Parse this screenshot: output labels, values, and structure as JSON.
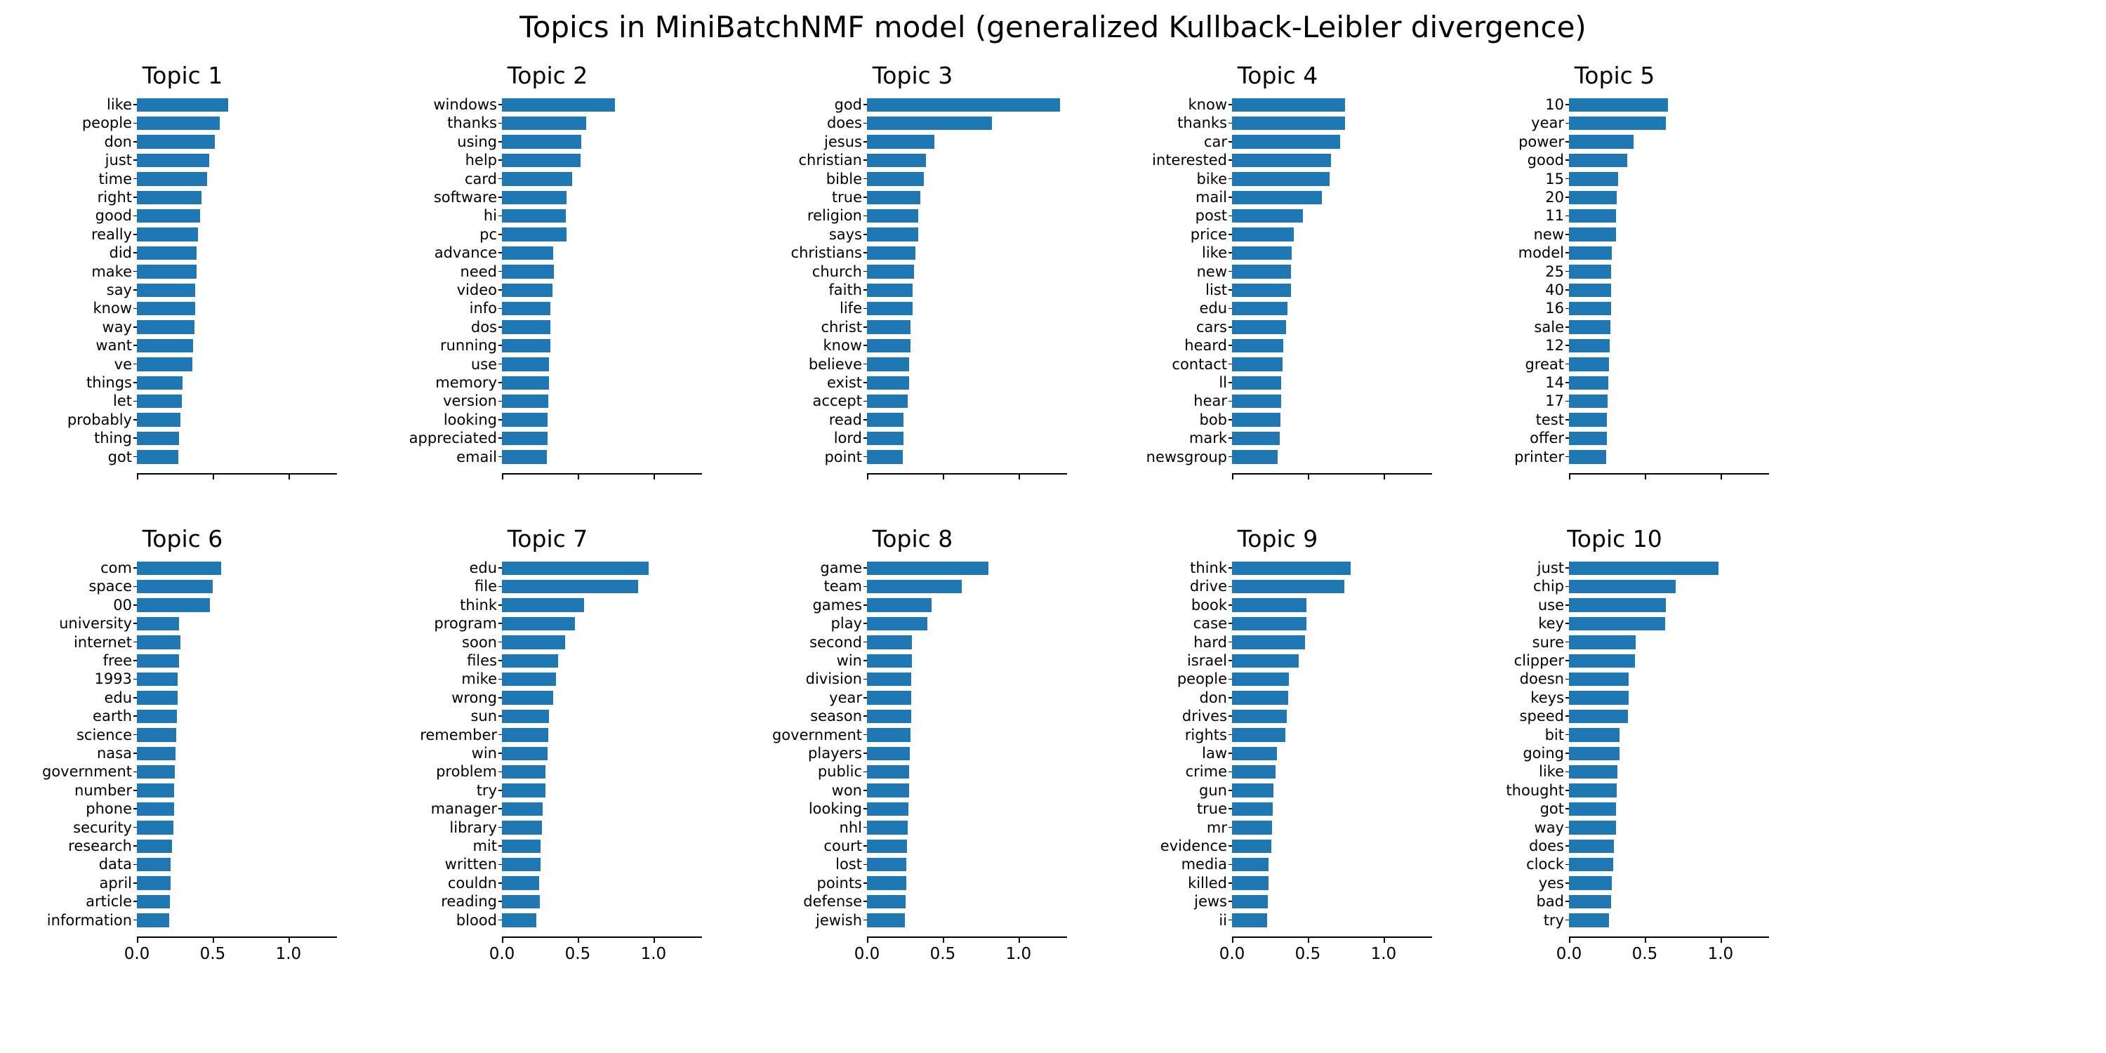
{
  "figure": {
    "title": "Topics in MiniBatchNMF model (generalized Kullback-Leibler divergence)",
    "bar_color": "#1f77b4",
    "background": "#ffffff",
    "rows": 2,
    "cols": 5
  },
  "axis": {
    "xticks": [
      0.0,
      0.5,
      1.0
    ],
    "xtick_labels": [
      "0.0",
      "0.5",
      "1.0"
    ],
    "xmin": 0.0,
    "xmax": 1.32,
    "xtick_labels_visible_rows": [
      1
    ]
  },
  "chart_data": {
    "type": "bar",
    "orientation": "horizontal",
    "title": "Topics in MiniBatchNMF model (generalized Kullback-Leibler divergence)",
    "xlabel": "",
    "ylabel": "",
    "xlim": [
      0.0,
      1.32
    ],
    "grid": false,
    "legend": null,
    "color": "#1f77b4",
    "subplot_layout": [
      2,
      5
    ],
    "panels": [
      {
        "title": "Topic 1",
        "categories": [
          "like",
          "people",
          "don",
          "just",
          "time",
          "right",
          "good",
          "really",
          "did",
          "make",
          "say",
          "know",
          "way",
          "want",
          "ve",
          "things",
          "let",
          "probably",
          "thing",
          "got"
        ],
        "values": [
          0.6,
          0.545,
          0.515,
          0.475,
          0.465,
          0.425,
          0.415,
          0.405,
          0.395,
          0.395,
          0.385,
          0.385,
          0.38,
          0.37,
          0.368,
          0.3,
          0.295,
          0.287,
          0.277,
          0.275
        ]
      },
      {
        "title": "Topic 2",
        "categories": [
          "windows",
          "thanks",
          "using",
          "help",
          "card",
          "software",
          "hi",
          "pc",
          "advance",
          "need",
          "video",
          "info",
          "dos",
          "running",
          "use",
          "memory",
          "version",
          "looking",
          "appreciated",
          "email"
        ],
        "values": [
          0.745,
          0.555,
          0.525,
          0.52,
          0.465,
          0.425,
          0.42,
          0.425,
          0.34,
          0.343,
          0.333,
          0.32,
          0.32,
          0.32,
          0.308,
          0.31,
          0.305,
          0.3,
          0.303,
          0.295
        ]
      },
      {
        "title": "Topic 3",
        "categories": [
          "god",
          "does",
          "jesus",
          "christian",
          "bible",
          "true",
          "religion",
          "says",
          "christians",
          "church",
          "faith",
          "life",
          "christ",
          "know",
          "believe",
          "exist",
          "accept",
          "read",
          "lord",
          "point"
        ],
        "values": [
          1.275,
          0.825,
          0.445,
          0.39,
          0.375,
          0.35,
          0.34,
          0.34,
          0.318,
          0.31,
          0.303,
          0.303,
          0.285,
          0.285,
          0.28,
          0.28,
          0.268,
          0.24,
          0.24,
          0.235
        ]
      },
      {
        "title": "Topic 4",
        "categories": [
          "know",
          "thanks",
          "car",
          "interested",
          "bike",
          "mail",
          "post",
          "price",
          "like",
          "new",
          "list",
          "edu",
          "cars",
          "heard",
          "contact",
          "ll",
          "hear",
          "bob",
          "mark",
          "newsgroup"
        ],
        "values": [
          0.745,
          0.745,
          0.715,
          0.655,
          0.645,
          0.595,
          0.47,
          0.408,
          0.395,
          0.39,
          0.39,
          0.365,
          0.355,
          0.34,
          0.333,
          0.325,
          0.323,
          0.318,
          0.313,
          0.3
        ]
      },
      {
        "title": "Topic 5",
        "categories": [
          "10",
          "year",
          "power",
          "good",
          "15",
          "20",
          "11",
          "new",
          "model",
          "25",
          "40",
          "16",
          "sale",
          "12",
          "great",
          "14",
          "17",
          "test",
          "offer",
          "printer"
        ],
        "values": [
          0.655,
          0.64,
          0.425,
          0.385,
          0.325,
          0.315,
          0.312,
          0.31,
          0.282,
          0.278,
          0.277,
          0.277,
          0.273,
          0.268,
          0.263,
          0.258,
          0.255,
          0.25,
          0.248,
          0.245
        ]
      },
      {
        "title": "Topic 6",
        "categories": [
          "com",
          "space",
          "00",
          "university",
          "internet",
          "free",
          "1993",
          "edu",
          "earth",
          "science",
          "nasa",
          "government",
          "number",
          "phone",
          "security",
          "research",
          "data",
          "april",
          "article",
          "information"
        ],
        "values": [
          0.555,
          0.5,
          0.48,
          0.28,
          0.285,
          0.278,
          0.27,
          0.268,
          0.263,
          0.258,
          0.253,
          0.248,
          0.245,
          0.245,
          0.243,
          0.23,
          0.222,
          0.222,
          0.218,
          0.215
        ]
      },
      {
        "title": "Topic 7",
        "categories": [
          "edu",
          "file",
          "think",
          "program",
          "soon",
          "files",
          "mike",
          "wrong",
          "sun",
          "remember",
          "win",
          "problem",
          "try",
          "manager",
          "library",
          "mit",
          "written",
          "couldn",
          "reading",
          "blood"
        ],
        "values": [
          0.97,
          0.9,
          0.54,
          0.48,
          0.415,
          0.37,
          0.355,
          0.34,
          0.31,
          0.305,
          0.3,
          0.287,
          0.285,
          0.268,
          0.265,
          0.255,
          0.255,
          0.245,
          0.25,
          0.225
        ]
      },
      {
        "title": "Topic 8",
        "categories": [
          "game",
          "team",
          "games",
          "play",
          "second",
          "win",
          "division",
          "year",
          "season",
          "government",
          "players",
          "public",
          "won",
          "looking",
          "nhl",
          "court",
          "lost",
          "points",
          "defense",
          "jewish"
        ],
        "values": [
          0.8,
          0.625,
          0.425,
          0.4,
          0.295,
          0.295,
          0.293,
          0.293,
          0.29,
          0.288,
          0.283,
          0.28,
          0.278,
          0.273,
          0.268,
          0.265,
          0.26,
          0.258,
          0.255,
          0.25
        ]
      },
      {
        "title": "Topic 9",
        "categories": [
          "think",
          "drive",
          "book",
          "case",
          "hard",
          "israel",
          "people",
          "don",
          "drives",
          "rights",
          "law",
          "crime",
          "gun",
          "true",
          "mr",
          "evidence",
          "media",
          "killed",
          "jews",
          "ii"
        ],
        "values": [
          0.785,
          0.74,
          0.49,
          0.49,
          0.48,
          0.44,
          0.375,
          0.37,
          0.363,
          0.35,
          0.298,
          0.285,
          0.272,
          0.268,
          0.265,
          0.258,
          0.243,
          0.24,
          0.235,
          0.23
        ]
      },
      {
        "title": "Topic 10",
        "categories": [
          "just",
          "chip",
          "use",
          "key",
          "sure",
          "clipper",
          "doesn",
          "keys",
          "speed",
          "bit",
          "going",
          "like",
          "thought",
          "got",
          "way",
          "does",
          "clock",
          "yes",
          "bad",
          "try"
        ],
        "values": [
          0.985,
          0.705,
          0.638,
          0.635,
          0.44,
          0.435,
          0.395,
          0.393,
          0.39,
          0.335,
          0.333,
          0.318,
          0.315,
          0.308,
          0.308,
          0.298,
          0.293,
          0.283,
          0.28,
          0.265
        ]
      }
    ]
  }
}
